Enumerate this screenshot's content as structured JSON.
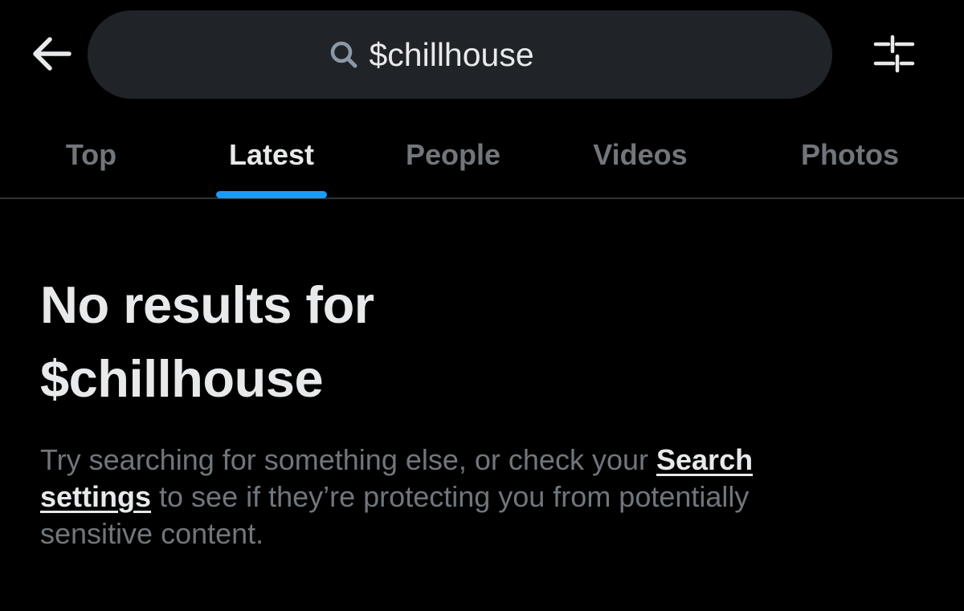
{
  "header": {
    "back_icon": "arrow-left-icon",
    "search": {
      "icon": "search-icon",
      "value": "$chillhouse"
    },
    "filter_icon": "sliders-icon"
  },
  "tabs": [
    {
      "label": "Top",
      "active": false
    },
    {
      "label": "Latest",
      "active": true
    },
    {
      "label": "People",
      "active": false
    },
    {
      "label": "Videos",
      "active": false
    },
    {
      "label": "Photos",
      "active": false
    }
  ],
  "empty_state": {
    "title_line1": "No results for",
    "title_line2": "$chillhouse",
    "body_before_link": "Try searching for something else, or check your ",
    "link_label": "Search settings",
    "body_after_link": " to see if they’re protecting you from potentially sensitive content."
  },
  "colors": {
    "background": "#000000",
    "search_pill": "#202327",
    "primary_text": "#e7e9ea",
    "secondary_text": "#71767b",
    "accent": "#1d9bf0",
    "divider": "#2f3336"
  }
}
